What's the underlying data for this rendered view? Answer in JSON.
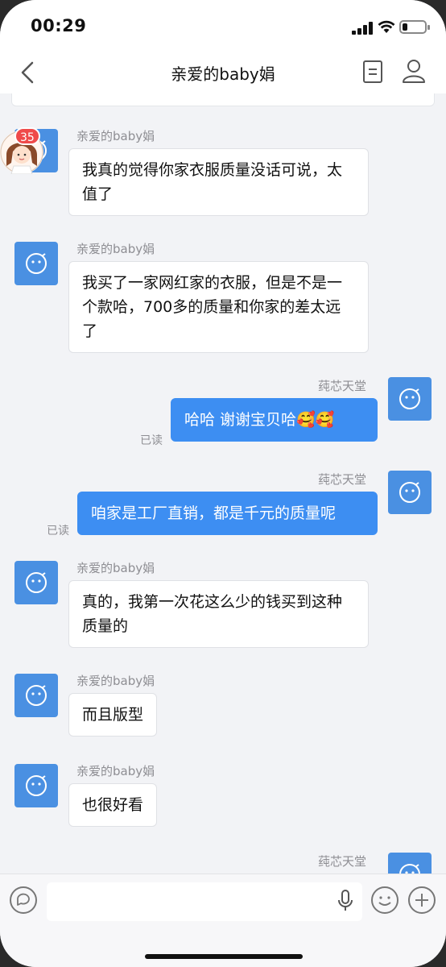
{
  "status_bar": {
    "time": "00:29"
  },
  "nav": {
    "title": "亲爱的baby娟"
  },
  "contact": {
    "name": "亲爱的baby娟",
    "unread_badge": "35"
  },
  "me": {
    "name": "莼芯天堂"
  },
  "messages": [
    {
      "sender": "亲爱的baby娟",
      "text": "我真的觉得你家衣服质量没话可说，太值了"
    },
    {
      "sender": "亲爱的baby娟",
      "text": "我买了一家网红家的衣服，但是不是一个款哈，700多的质量和你家的差太远了"
    },
    {
      "sender": "莼芯天堂",
      "text": "哈哈 谢谢宝贝哈",
      "emoji": "🥰🥰",
      "status": "已读"
    },
    {
      "sender": "莼芯天堂",
      "text": "咱家是工厂直销，都是千元的质量呢",
      "status": "已读"
    },
    {
      "sender": "亲爱的baby娟",
      "text": "真的，我第一次花这么少的钱买到这种质量的"
    },
    {
      "sender": "亲爱的baby娟",
      "text": "而且版型"
    },
    {
      "sender": "亲爱的baby娟",
      "text": "也很好看"
    },
    {
      "sender": "莼芯天堂",
      "text": ""
    }
  ],
  "input": {
    "placeholder": ""
  },
  "colors": {
    "accent": "#3d8ef2",
    "avatar_blue": "#4a90e2",
    "badge_red": "#ef4a4a",
    "background": "#f2f3f6"
  },
  "icons": [
    "back-icon",
    "notes-icon",
    "profile-icon",
    "bot-face-icon",
    "chat-bubble-icon",
    "microphone-icon",
    "smiley-icon",
    "plus-icon"
  ]
}
